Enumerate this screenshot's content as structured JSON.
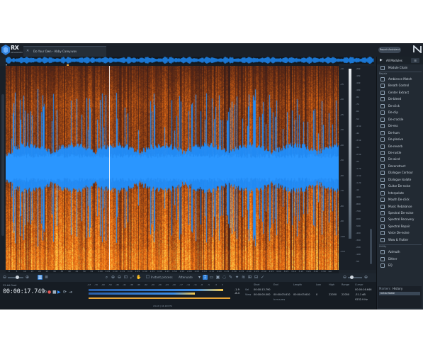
{
  "app": {
    "logo_text": "RX",
    "logo_subtitle": "ADVANCED",
    "file_tab_close": "✕",
    "file_tab_name": "Do Your Own - Abby Carey.wav",
    "repair_assistant_label": "Repair Assistant",
    "brand_mark": "ℵ"
  },
  "spectrogram": {
    "freq_ticks": [
      "-20k",
      "-15k",
      "-12k",
      "-10k",
      "-8k",
      "-7k",
      "-6k",
      "-5k",
      "-4.5k",
      "-4k",
      "-3.5k",
      "-3k",
      "-2.5k",
      "-2k",
      "-1.7k",
      "-1.5k",
      "-1.2k",
      "-1k",
      "-900",
      "-800",
      "-700",
      "-600",
      "-500",
      "-400",
      "-300",
      "-200",
      "-100",
      "-50"
    ],
    "db_ticks": [
      "-10",
      "-15",
      "-20",
      "-25",
      "-30",
      "-40",
      "-50",
      "-60",
      "-70",
      "-80",
      "-90",
      "-100",
      "-110"
    ],
    "time_ticks": [
      "0",
      "5",
      "10",
      "15",
      "20",
      "25",
      "30",
      "35",
      "40",
      "45",
      "50",
      "55",
      "1:00",
      "1:05",
      "1:10",
      "1:15",
      "1:20",
      "1:25",
      "1:30",
      "1:35",
      "1:40",
      "1:45",
      "1:50",
      "1:55",
      "2:00",
      "2:05",
      "2:10",
      "2:15",
      "2:20",
      "2:25",
      "2:30",
      "2:35",
      "2:40",
      "2:45",
      "2:50",
      "2:55",
      "3:00",
      "3:05",
      "3:10",
      "3:15",
      "3:20",
      "3:25",
      "3:30",
      "sec"
    ],
    "playhead_pct": 31,
    "colors": {
      "waveform": "#1e8fff",
      "spectro_hot": "#ff9a1e",
      "spectro_cool": "#142033"
    }
  },
  "toolbar": {
    "instant_process_label": "Instant process",
    "attenuate_label": "Attenuate",
    "zoom_label": "Zoom"
  },
  "transport": {
    "format_label": "32-bit float",
    "timecode": "00:00:17.749",
    "buttons": [
      "⟲",
      "●",
      "■",
      "▶",
      "⟳",
      "⇥"
    ]
  },
  "meter": {
    "scale": [
      "-Inf",
      "-70",
      "-60",
      "-50",
      "-45",
      "-41",
      "-38",
      "-35",
      "-32",
      "-29",
      "-26",
      "-23",
      "-20",
      "-17",
      "-14",
      "-11",
      "-8",
      "-5",
      "-3",
      "0"
    ],
    "left_peak": "-1.9",
    "right_peak": "-8.4",
    "footer": "24-bit | 44,100 Hz"
  },
  "selection": {
    "headers": [
      "Start",
      "End",
      "Length",
      "Low",
      "High",
      "Range",
      "Cursor"
    ],
    "rows": [
      {
        "label": "Sel",
        "start": "00:00:13.790",
        "end": "",
        "length": "",
        "low": "",
        "high": "",
        "range": "",
        "cursor": "00:00:16.646"
      },
      {
        "label": "View",
        "start": "00:00:00.000",
        "end": "00:00:03.610",
        "length": "00:00:03.610",
        "low": "0",
        "high": "22050",
        "range": "22050",
        "cursor": "-31.1 dB"
      }
    ],
    "footer": "h:m:s.ms",
    "cursor_extra": "9232.9 Hz"
  },
  "panel": {
    "header_title": "All Modules",
    "menu_label": "☰",
    "module_chain": "Module Chain",
    "repair_section": "Repair",
    "utility_section": "Utility",
    "repair_modules": [
      "Ambience Match",
      "Breath Control",
      "Center Extract",
      "De-bleed",
      "De-click",
      "De-clip",
      "De-crackle",
      "De-ess",
      "De-hum",
      "De-plosive",
      "De-reverb",
      "De-rustle",
      "De-wind",
      "Deconstruct",
      "Dialogue Contour",
      "Dialogue Isolate",
      "Guitar De-noise",
      "Interpolate",
      "Mouth De-click",
      "Music Rebalance",
      "Spectral De-noise",
      "Spectral Recovery",
      "Spectral Repair",
      "Voice De-noise",
      "Wow & Flutter"
    ],
    "utility_modules": [
      "Azimuth",
      "Dither",
      "EQ"
    ],
    "history_tab": "History",
    "markers_tab": "Markers",
    "history_item": "Initial State"
  }
}
